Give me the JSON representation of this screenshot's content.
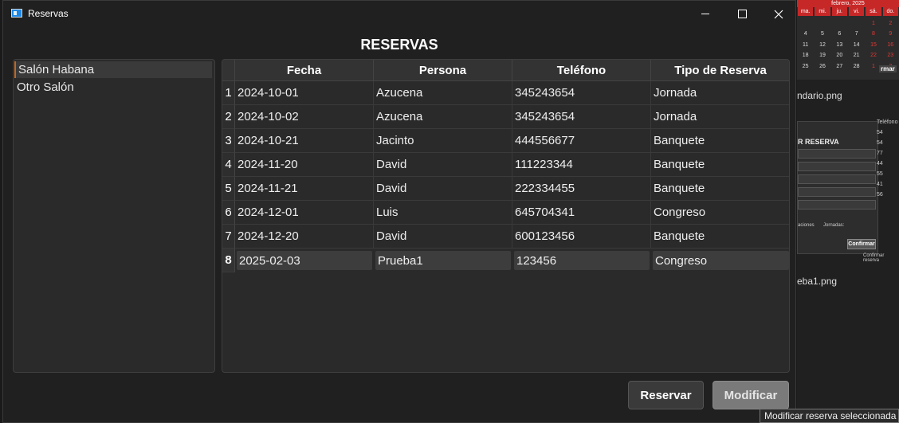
{
  "window": {
    "title": "Reservas",
    "heading": "RESERVAS"
  },
  "salons": [
    {
      "label": "Salón Habana",
      "selected": true
    },
    {
      "label": "Otro Salón",
      "selected": false
    }
  ],
  "table": {
    "columns": [
      "Fecha",
      "Persona",
      "Teléfono",
      "Tipo de Reserva"
    ],
    "rows": [
      {
        "num": "1",
        "fecha": "2024-10-01",
        "persona": "Azucena",
        "telefono": "345243654",
        "tipo": "Jornada"
      },
      {
        "num": "2",
        "fecha": "2024-10-02",
        "persona": "Azucena",
        "telefono": "345243654",
        "tipo": "Jornada"
      },
      {
        "num": "3",
        "fecha": "2024-10-21",
        "persona": "Jacinto",
        "telefono": "444556677",
        "tipo": "Banquete"
      },
      {
        "num": "4",
        "fecha": "2024-11-20",
        "persona": "David",
        "telefono": "111223344",
        "tipo": "Banquete"
      },
      {
        "num": "5",
        "fecha": "2024-11-21",
        "persona": "David",
        "telefono": "222334455",
        "tipo": "Banquete"
      },
      {
        "num": "6",
        "fecha": "2024-12-01",
        "persona": "Luis",
        "telefono": "645704341",
        "tipo": "Congreso"
      },
      {
        "num": "7",
        "fecha": "2024-12-20",
        "persona": "David",
        "telefono": "600123456",
        "tipo": "Banquete"
      },
      {
        "num": "8",
        "fecha": "2025-02-03",
        "persona": "Prueba1",
        "telefono": "123456",
        "tipo": "Congreso"
      }
    ],
    "selected_row": "8"
  },
  "buttons": {
    "reservar": "Reservar",
    "modificar": "Modificar"
  },
  "tooltip": "Modificar reserva seleccionada",
  "background": {
    "calendar_month": "febrero,  2025",
    "calendar_dow": [
      "ma.",
      "mi.",
      "ju.",
      "vi.",
      "sá.",
      "do."
    ],
    "calendar_rows": [
      [
        "",
        "",
        "",
        "",
        "1",
        "2"
      ],
      [
        "4",
        "5",
        "6",
        "7",
        "8",
        "9"
      ],
      [
        "11",
        "12",
        "13",
        "14",
        "15",
        "16"
      ],
      [
        "18",
        "19",
        "20",
        "21",
        "22",
        "23"
      ],
      [
        "25",
        "26",
        "27",
        "28",
        "1",
        "2"
      ]
    ],
    "confirmar_partial": "rmar",
    "file1": "ndario.png",
    "file2": "eba1.png",
    "dialog_title": "R RESERVA",
    "dialog_label1": "aciones",
    "dialog_label2": "Jornadas:",
    "dialog_button": "Confirmar",
    "dialog_hint": "Confirmar reserva",
    "telefono_col_header": "Teléfono",
    "telefono_col_values": [
      "54",
      "54",
      "77",
      "44",
      "55",
      "41",
      "56"
    ]
  },
  "colors": {
    "window_bg": "#202020",
    "accent_selected": "#b86a2a",
    "calendar_red": "#c62828"
  }
}
